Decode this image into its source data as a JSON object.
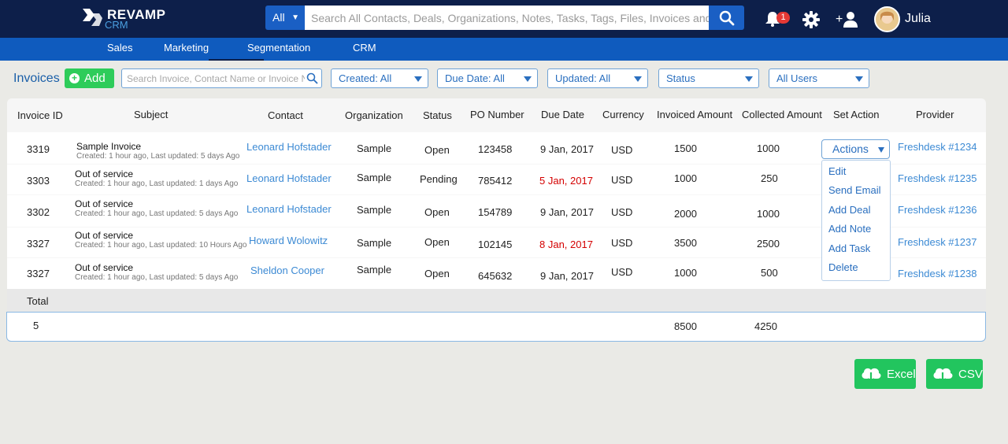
{
  "header": {
    "logo_text": "REVAMP",
    "logo_sub": "CRM",
    "search_scope": "All",
    "search_placeholder": "Search All Contacts, Deals, Organizations, Notes, Tasks, Tags, Files, Invoices and Tickets",
    "notification_count": "1",
    "user_name": "Julia"
  },
  "nav": {
    "items": [
      {
        "label": "Sales"
      },
      {
        "label": "Marketing"
      },
      {
        "label": "Segmentation"
      },
      {
        "label": "CRM"
      }
    ]
  },
  "toolbar": {
    "title": "Invoices",
    "add_label": "Add",
    "search_placeholder": "Search Invoice, Contact Name or Invoice No",
    "filters": [
      "Created: All",
      "Due Date: All",
      "Updated: All",
      "Status",
      "All Users"
    ]
  },
  "table": {
    "columns": [
      "Invoice ID",
      "Subject",
      "Contact",
      "Organization",
      "Status",
      "PO Number",
      "Due Date",
      "Currency",
      "Invoiced Amount",
      "Collected Amount",
      "Set Action",
      "Provider"
    ],
    "rows": [
      {
        "id": "3319",
        "subject": "Sample Invoice",
        "meta": "Created: 1 hour ago, Last updated: 5 days Ago",
        "contact": "Leonard Hofstader",
        "org": "Sample",
        "status": "Open",
        "po": "123458",
        "due": "9 Jan, 2017",
        "overdue": false,
        "currency": "USD",
        "invoiced": "1500",
        "collected": "1000",
        "provider": "Freshdesk #1234"
      },
      {
        "id": "3303",
        "subject": "Out of service",
        "meta": "Created: 1 hour ago, Last updated: 1 days Ago",
        "contact": "Leonard Hofstader",
        "org": "Sample",
        "status": "Pending",
        "po": "785412",
        "due": "5 Jan, 2017",
        "overdue": true,
        "currency": "USD",
        "invoiced": "1000",
        "collected": "250",
        "provider": "Freshdesk #1235"
      },
      {
        "id": "3302",
        "subject": "Out of service",
        "meta": "Created: 1 hour ago, Last updated: 5 days Ago",
        "contact": "Leonard Hofstader",
        "org": "Sample",
        "status": "Open",
        "po": "154789",
        "due": "9 Jan, 2017",
        "overdue": false,
        "currency": "USD",
        "invoiced": "2000",
        "collected": "1000",
        "provider": "Freshdesk #1236"
      },
      {
        "id": "3327",
        "subject": "Out of service",
        "meta": "Created: 1 hour ago, Last updated: 10 Hours Ago",
        "contact": "Howard Wolowitz",
        "org": "Sample",
        "status": "Open",
        "po": "102145",
        "due": "8 Jan, 2017",
        "overdue": true,
        "currency": "USD",
        "invoiced": "3500",
        "collected": "2500",
        "provider": "Freshdesk #1237"
      },
      {
        "id": "3327",
        "subject": "Out of service",
        "meta": "Created: 1 hour ago, Last updated: 5 days Ago",
        "contact": "Sheldon Cooper",
        "org": "Sample",
        "status": "Open",
        "po": "645632",
        "due": "9 Jan, 2017",
        "overdue": false,
        "currency": "USD",
        "invoiced": "1000",
        "collected": "500",
        "provider": "Freshdesk #1238"
      }
    ],
    "total_label": "Total",
    "total_count": "5",
    "total_invoiced": "8500",
    "total_collected": "4250"
  },
  "actions": {
    "button_label": "Actions",
    "menu": [
      "Edit",
      "Send Email",
      "Add Deal",
      "Add Note",
      "Add Task",
      "Delete"
    ]
  },
  "export": {
    "excel_label": "Excel",
    "csv_label": "CSV"
  },
  "colors": {
    "header_bg": "#0d1f4a",
    "nav_bg": "#0f5bbe",
    "accent_green": "#2ecc5a",
    "link_blue": "#3c8ad4",
    "overdue_red": "#d40000"
  }
}
